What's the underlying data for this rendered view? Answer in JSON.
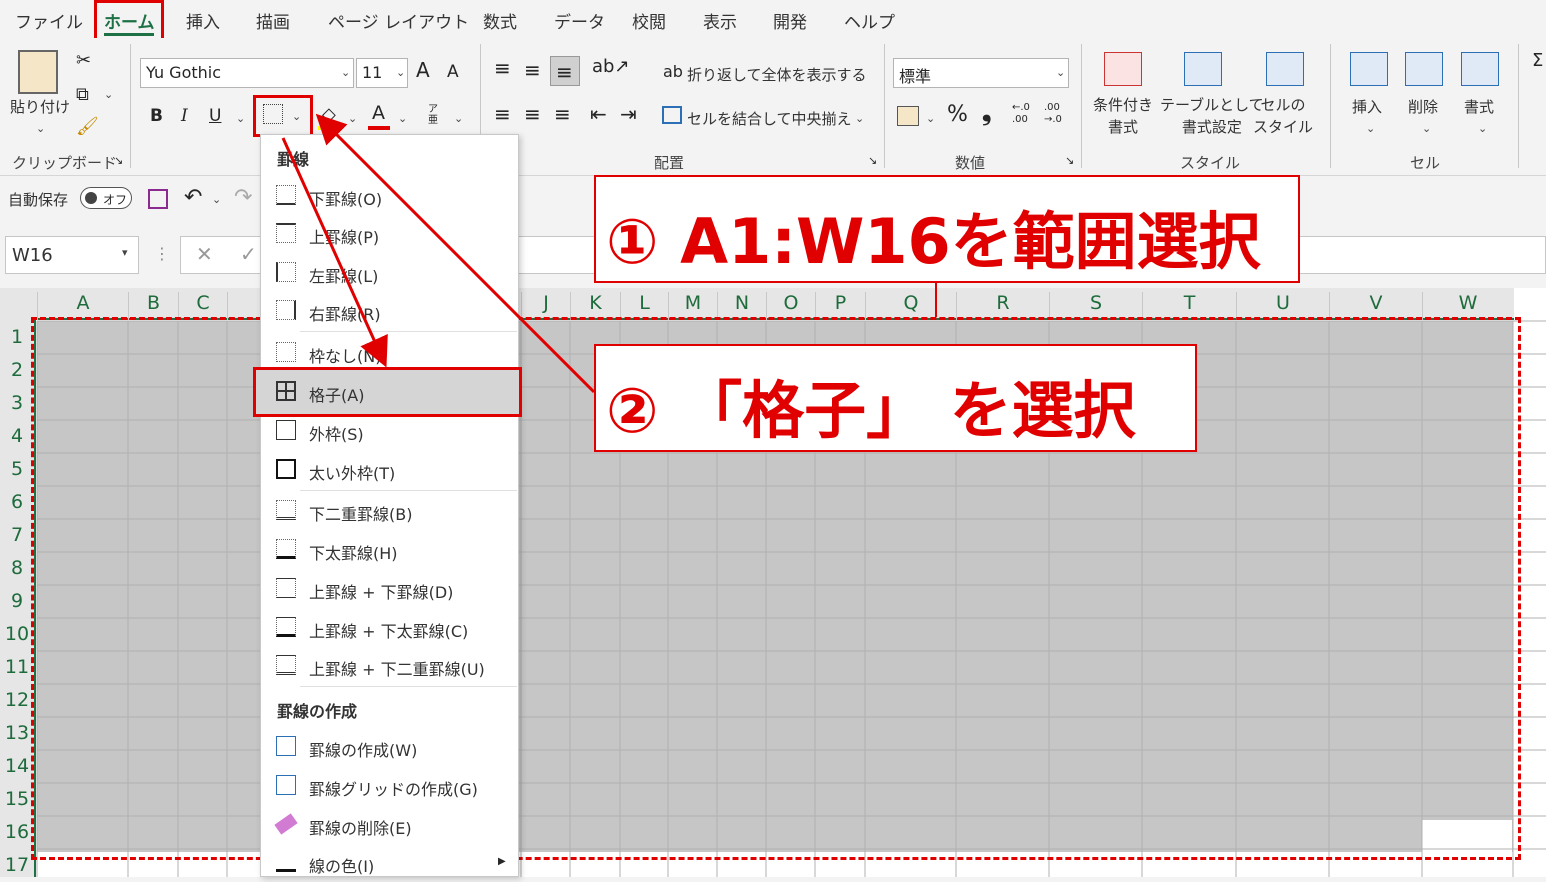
{
  "tabs": [
    "ファイル",
    "ホーム",
    "挿入",
    "描画",
    "ページ レイアウト",
    "数式",
    "データ",
    "校閲",
    "表示",
    "開発",
    "ヘルプ"
  ],
  "ribbon": {
    "clipboard": {
      "paste_label": "貼り付け",
      "group_label": "クリップボード"
    },
    "font": {
      "font_name": "Yu Gothic",
      "font_size": "11",
      "bold": "B",
      "italic": "I",
      "underline": "U",
      "font_color_glyph": "A",
      "grow_glyph": "A",
      "shrink_glyph": "A",
      "phonetic_glyph": "ア亜"
    },
    "alignment": {
      "wrap_label": "折り返して全体を表示する",
      "merge_label": "セルを結合して中央揃え",
      "group_label": "配置"
    },
    "number": {
      "format": "標準",
      "percent": "%",
      "comma": "❟",
      "inc_decimal": "←.0\n.00",
      "dec_decimal": ".00\n→.0",
      "group_label": "数値"
    },
    "styles": {
      "conditional_label": "条件付き\n書式",
      "table_label": "テーブルとして\n書式設定",
      "cell_style_label": "セルの\nスタイル",
      "group_label": "スタイル"
    },
    "cells": {
      "insert_label": "挿入",
      "delete_label": "削除",
      "format_label": "書式",
      "group_label": "セル"
    }
  },
  "qat": {
    "autosave_label": "自動保存",
    "autosave_state": "オフ"
  },
  "formula_bar": {
    "name_box": "W16"
  },
  "sheet": {
    "columns": [
      "A",
      "B",
      "C",
      "D",
      "J",
      "K",
      "L",
      "M",
      "N",
      "O",
      "P",
      "Q",
      "R",
      "S",
      "T",
      "U",
      "V",
      "W"
    ],
    "rows": [
      "1",
      "2",
      "3",
      "4",
      "5",
      "6",
      "7",
      "8",
      "9",
      "10",
      "11",
      "12",
      "13",
      "14",
      "15",
      "16",
      "17"
    ]
  },
  "border_menu": {
    "heading1": "罫線",
    "items": [
      {
        "label": "下罫線(O)"
      },
      {
        "label": "上罫線(P)"
      },
      {
        "label": "左罫線(L)"
      },
      {
        "label": "右罫線(R)"
      },
      {
        "label": "枠なし(N)"
      },
      {
        "label": "格子(A)"
      },
      {
        "label": "外枠(S)"
      },
      {
        "label": "太い外枠(T)"
      },
      {
        "label": "下二重罫線(B)"
      },
      {
        "label": "下太罫線(H)"
      },
      {
        "label": "上罫線 + 下罫線(D)"
      },
      {
        "label": "上罫線 + 下太罫線(C)"
      },
      {
        "label": "上罫線 + 下二重罫線(U)"
      }
    ],
    "heading2": "罫線の作成",
    "draw_items": [
      {
        "label": "罫線の作成(W)"
      },
      {
        "label": "罫線グリッドの作成(G)"
      },
      {
        "label": "罫線の削除(E)"
      },
      {
        "label": "線の色(I)"
      }
    ]
  },
  "callouts": {
    "step1": "① A1:W16を範囲選択",
    "step2": "② 「格子」 を選択"
  },
  "colors": {
    "accent_red": "#e00000",
    "excel_green": "#1e7145",
    "selection": "#c6c6c6"
  }
}
